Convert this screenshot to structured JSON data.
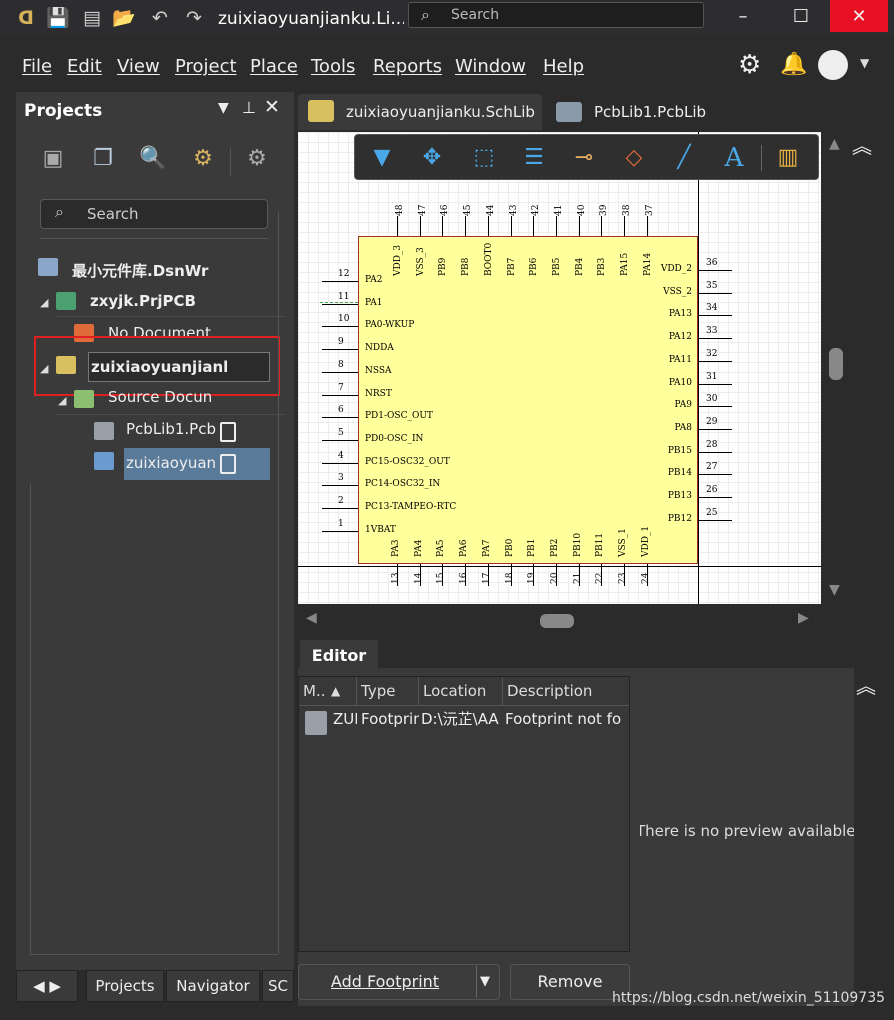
{
  "window": {
    "title": "zuixiaoyuanjianku.Li...",
    "search_placeholder": "Search",
    "minimize": "–",
    "maximize": "☐",
    "close": "✕"
  },
  "menu": [
    "File",
    "Edit",
    "View",
    "Project",
    "Place",
    "Tools",
    "Reports",
    "Window",
    "Help"
  ],
  "projects_panel": {
    "title": "Projects",
    "search_placeholder": "Search",
    "tree": {
      "workspace": "最小元件库.DsnWr",
      "project": "zxyjk.PrjPCB",
      "no_document": "No Document",
      "library_project": "zuixiaoyuanjianl",
      "source_documents": "Source Docun",
      "pcblib": "PcbLib1.Pcb",
      "schlib": "zuixiaoyuan"
    },
    "bottom_tabs": [
      "Projects",
      "Navigator",
      "SC"
    ]
  },
  "doc_tabs": [
    {
      "label": "zuixiaoyuanjianku.SchLib",
      "active": true
    },
    {
      "label": "PcbLib1.PcbLib",
      "active": false
    }
  ],
  "schematic": {
    "top_pins": [
      {
        "num": "48",
        "name": "VDD_3"
      },
      {
        "num": "47",
        "name": "VSS_3"
      },
      {
        "num": "46",
        "name": "PB9"
      },
      {
        "num": "45",
        "name": "PB8"
      },
      {
        "num": "44",
        "name": "BOOT0"
      },
      {
        "num": "43",
        "name": "PB7"
      },
      {
        "num": "42",
        "name": "PB6"
      },
      {
        "num": "41",
        "name": "PB5"
      },
      {
        "num": "40",
        "name": "PB4"
      },
      {
        "num": "39",
        "name": "PB3"
      },
      {
        "num": "38",
        "name": "PA15"
      },
      {
        "num": "37",
        "name": "PA14"
      }
    ],
    "left_pins": [
      {
        "num": "12",
        "name": "PA2"
      },
      {
        "num": "11",
        "name": "PA1"
      },
      {
        "num": "10",
        "name": "PA0-WKUP"
      },
      {
        "num": "9",
        "name": "NDDA"
      },
      {
        "num": "8",
        "name": "NSSA"
      },
      {
        "num": "7",
        "name": "NRST"
      },
      {
        "num": "6",
        "name": "PD1-OSC_OUT"
      },
      {
        "num": "5",
        "name": "PD0-OSC_IN"
      },
      {
        "num": "4",
        "name": "PC15-OSC32_OUT"
      },
      {
        "num": "3",
        "name": "PC14-OSC32_IN"
      },
      {
        "num": "2",
        "name": "PC13-TAMPEO-RTC"
      },
      {
        "num": "1",
        "name": "1VBAT"
      }
    ],
    "right_pins": [
      {
        "num": "36",
        "name": "VDD_2"
      },
      {
        "num": "35",
        "name": "VSS_2"
      },
      {
        "num": "34",
        "name": "PA13"
      },
      {
        "num": "33",
        "name": "PA12"
      },
      {
        "num": "32",
        "name": "PA11"
      },
      {
        "num": "31",
        "name": "PA10"
      },
      {
        "num": "30",
        "name": "PA9"
      },
      {
        "num": "29",
        "name": "PA8"
      },
      {
        "num": "28",
        "name": "PB15"
      },
      {
        "num": "27",
        "name": "PB14"
      },
      {
        "num": "26",
        "name": "PB13"
      },
      {
        "num": "25",
        "name": "PB12"
      }
    ],
    "bottom_pins": [
      {
        "num": "13",
        "name": "PA3"
      },
      {
        "num": "14",
        "name": "PA4"
      },
      {
        "num": "15",
        "name": "PA5"
      },
      {
        "num": "16",
        "name": "PA6"
      },
      {
        "num": "17",
        "name": "PA7"
      },
      {
        "num": "18",
        "name": "PB0"
      },
      {
        "num": "19",
        "name": "PB1"
      },
      {
        "num": "20",
        "name": "PB2"
      },
      {
        "num": "21",
        "name": "PB10"
      },
      {
        "num": "22",
        "name": "PB11"
      },
      {
        "num": "23",
        "name": "VSS_1"
      },
      {
        "num": "24",
        "name": "VDD_1"
      }
    ]
  },
  "editor": {
    "tab": "Editor",
    "columns": [
      "M..",
      "Type",
      "Location",
      "Description"
    ],
    "rows": [
      {
        "model": "ZUI",
        "type": "Footprint",
        "location": "D:\\沅芷\\AA",
        "description": "Footprint not fo"
      }
    ],
    "preview_text": "There is no preview available",
    "add_button": "Add Footprint",
    "remove_button": "Remove"
  },
  "watermark": "https://blog.csdn.net/weixin_51109735",
  "colors": {
    "highlight_box": "#e02020",
    "chip_fill": "#ffff9c",
    "selected_row": "#5a7a9a"
  }
}
